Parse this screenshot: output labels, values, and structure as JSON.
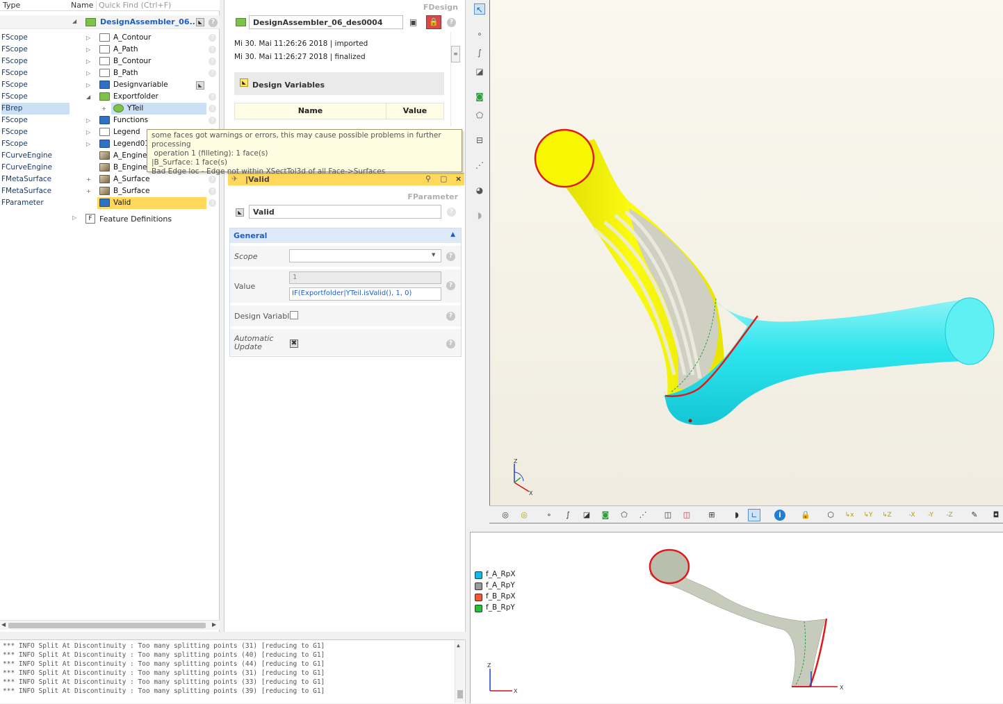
{
  "tree": {
    "headers": {
      "type": "Type",
      "name": "Name",
      "quick_find": "Quick Find (Ctrl+F)"
    },
    "root_label": "DesignAssembler_06...",
    "rows": [
      {
        "type": "FScope",
        "name": "A_Contour",
        "icon": "folder-white",
        "toggle": "▷"
      },
      {
        "type": "FScope",
        "name": "A_Path",
        "icon": "folder-white",
        "toggle": "▷"
      },
      {
        "type": "FScope",
        "name": "B_Contour",
        "icon": "folder-white",
        "toggle": "▷"
      },
      {
        "type": "FScope",
        "name": "B_Path",
        "icon": "folder-white",
        "toggle": "▷"
      },
      {
        "type": "FScope",
        "name": "Designvariable",
        "icon": "folder-blue",
        "toggle": "▷"
      },
      {
        "type": "FScope",
        "name": "Exportfolder",
        "icon": "folder-green",
        "toggle": "◢"
      },
      {
        "type": "FBrep",
        "name": "YTeil",
        "icon": "brep-icon",
        "toggle": "+"
      },
      {
        "type": "FScope",
        "name": "Functions",
        "icon": "folder-blue",
        "toggle": "▷"
      },
      {
        "type": "FScope",
        "name": "Legend",
        "icon": "folder-white",
        "toggle": "▷"
      },
      {
        "type": "FScope",
        "name": "Legend01",
        "icon": "folder-blue",
        "toggle": "▷"
      },
      {
        "type": "FCurveEngine",
        "name": "A_Engine",
        "icon": "engine-icon",
        "toggle": ""
      },
      {
        "type": "FCurveEngine",
        "name": "B_Engine",
        "icon": "engine-icon",
        "toggle": ""
      },
      {
        "type": "FMetaSurface",
        "name": "A_Surface",
        "icon": "surface-icon",
        "toggle": "+"
      },
      {
        "type": "FMetaSurface",
        "name": "B_Surface",
        "icon": "surface-icon",
        "toggle": "+"
      },
      {
        "type": "FParameter",
        "name": "Valid",
        "icon": "parameter-icon",
        "toggle": ""
      }
    ],
    "feature_definitions": "Feature Definitions"
  },
  "design": {
    "header": "FDesign",
    "name_value": "DesignAssembler_06_des0004",
    "history": [
      "Mi 30. Mai 11:26:26 2018 | imported",
      "Mi 30. Mai 11:26:27 2018 | finalized"
    ],
    "design_variables_title": "Design Variables",
    "table_headers": [
      "Name",
      "Value"
    ]
  },
  "tooltip": {
    "lines": [
      "some faces got warnings or errors, this may cause possible problems in further processing",
      " operation 1 (filleting): 1 face(s)",
      "|B_Surface: 1 face(s)",
      "Bad Edge loc - Edge not within XSectTol3d of all Face->Surfaces"
    ]
  },
  "param": {
    "tab_title": "|Valid",
    "header": "FParameter",
    "name_value": "Valid",
    "section": "General",
    "scope_label": "Scope",
    "scope_value": "",
    "value_label": "Value",
    "value_result": "1",
    "value_expr": "IF(Exportfolder|YTeil.isValid(), 1, 0)",
    "design_variable_label": "Design Variable",
    "automatic_update_label": "Automatic Update"
  },
  "log": {
    "lines": [
      "*** INFO Split At Discontinuity : Too many splitting points (31) [reducing to G1]",
      "*** INFO Split At Discontinuity : Too many splitting points (40) [reducing to G1]",
      "*** INFO Split At Discontinuity : Too many splitting points (44) [reducing to G1]",
      "*** INFO Split At Discontinuity : Too many splitting points (31) [reducing to G1]",
      "*** INFO Split At Discontinuity : Too many splitting points (33) [reducing to G1]",
      "*** INFO Split At Discontinuity : Too many splitting points (39) [reducing to G1]"
    ]
  },
  "viewport": {
    "axis_labels": {
      "z": "Z",
      "x": "X"
    },
    "view_buttons": [
      "-X",
      "-Y",
      "-Z"
    ]
  },
  "legend": [
    {
      "label": "f_A_RpX",
      "color": "#19b6e8"
    },
    {
      "label": "f_A_RpY",
      "color": "#9a9a9a"
    },
    {
      "label": "f_B_RpX",
      "color": "#f05a3a"
    },
    {
      "label": "f_B_RpY",
      "color": "#2bbd3a"
    }
  ],
  "colors": {
    "accent": "#1f5fbf",
    "selection": "#ffd85c",
    "section_header": "#dde9f6"
  }
}
